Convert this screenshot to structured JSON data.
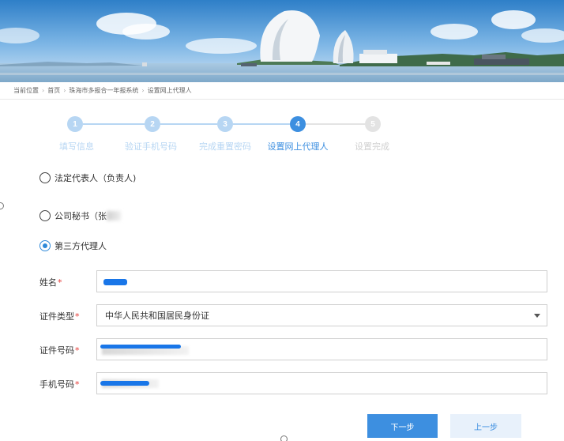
{
  "breadcrumb": {
    "items": [
      "当前位置",
      "首页",
      "珠海市多报合一年报系统",
      "设置网上代理人"
    ]
  },
  "steps": [
    {
      "number": "1",
      "label": "填写信息",
      "state": "done"
    },
    {
      "number": "2",
      "label": "验证手机号码",
      "state": "done"
    },
    {
      "number": "3",
      "label": "完成重置密码",
      "state": "done"
    },
    {
      "number": "4",
      "label": "设置网上代理人",
      "state": "active"
    },
    {
      "number": "5",
      "label": "设置完成",
      "state": "pending"
    }
  ],
  "agent_options": [
    {
      "label": "法定代表人（负责人)",
      "checked": false
    },
    {
      "label": "公司秘书（张",
      "checked": false
    },
    {
      "label": "第三方代理人",
      "checked": true
    }
  ],
  "form": {
    "name_label": "姓名",
    "id_type_label": "证件类型",
    "id_type_value": "中华人民共和国居民身份证",
    "id_number_label": "证件号码",
    "phone_label": "手机号码",
    "required_mark": "*"
  },
  "buttons": {
    "next": "下一步",
    "prev": "上一步"
  },
  "colors": {
    "accent": "#3d8fe0",
    "step_done": "#b7d6f3",
    "step_pending": "#e3e3e3",
    "required": "#e53935"
  }
}
